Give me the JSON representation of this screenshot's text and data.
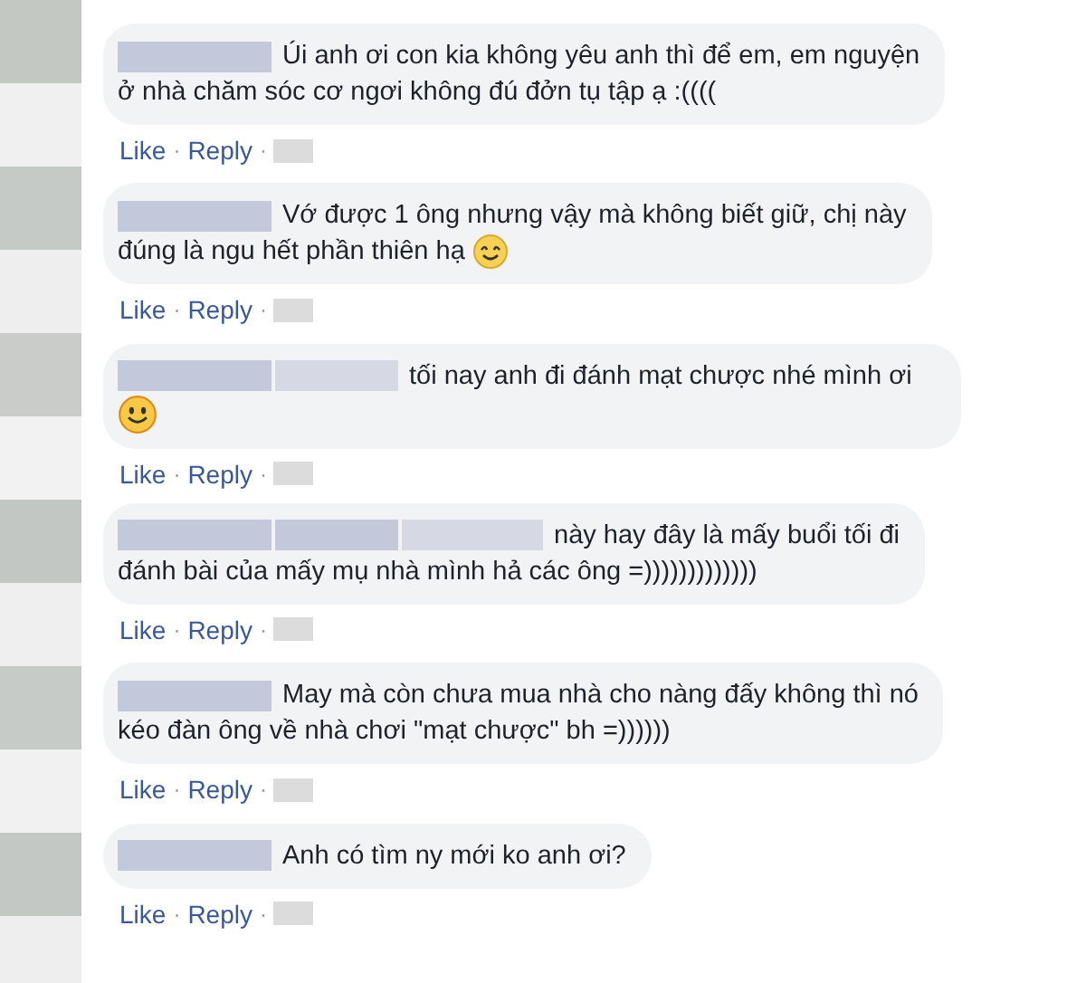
{
  "separator": "·",
  "comments": [
    {
      "redactions": [
        {
          "kind": "strong"
        }
      ],
      "lines": [
        "Úi anh ơi con kia không yêu anh thì để em, em nguyện",
        "ở nhà chăm sóc cơ ngơi không đú đởn tụ tập ạ :(((("
      ],
      "actions": [
        "Like",
        "Reply"
      ]
    },
    {
      "redactions": [
        {
          "kind": "strong"
        }
      ],
      "lines": [
        "Vớ được 1 ông nhưng vậy mà không biết giữ, chị này",
        "đúng là ngu hết phần thiên hạ"
      ],
      "emoji": {
        "kind": "grin"
      },
      "actions": [
        "Like",
        "Reply"
      ]
    },
    {
      "redactions": [
        {
          "kind": "strong"
        },
        {
          "kind": "faint"
        }
      ],
      "lines": [
        "tối nay anh đi đánh mạt chược nhé mình ơi"
      ],
      "emoji": {
        "kind": "smile"
      },
      "actions": [
        "Like",
        "Reply"
      ]
    },
    {
      "redactions": [
        {
          "kind": "strong"
        },
        {
          "kind": "strong"
        },
        {
          "kind": "faint"
        }
      ],
      "lines": [
        "này hay đây là mấy buổi tối đi",
        "đánh bài của mấy mụ nhà mình hả các ông =)))))))))))))"
      ],
      "actions": [
        "Like",
        "Reply"
      ]
    },
    {
      "redactions": [
        {
          "kind": "strong"
        }
      ],
      "lines": [
        "May mà còn chưa mua nhà cho nàng đấy không thì nó",
        "kéo đàn ông về nhà chơi \"mạt chược\" bh =))))))"
      ],
      "actions": [
        "Like",
        "Reply"
      ]
    },
    {
      "redactions": [
        {
          "kind": "strong"
        }
      ],
      "lines": [
        "Anh có tìm ny mới ko anh ơi?"
      ],
      "actions": [
        "Like",
        "Reply"
      ]
    }
  ]
}
